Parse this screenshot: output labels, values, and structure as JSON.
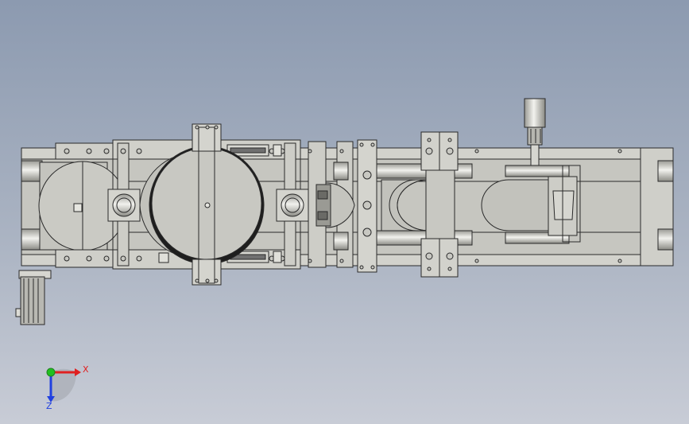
{
  "triad": {
    "x_label": "X",
    "z_label": "Z",
    "x_color": "#e02020",
    "y_color": "#20c020",
    "z_color": "#2040e0"
  },
  "colors": {
    "background_top": "#8c9ab0",
    "background_bottom": "#c8ccd6",
    "part_fill": "#c8c8c2",
    "part_fill_light": "#d8d8d2",
    "part_fill_dark": "#a8a8a2",
    "edge": "#2a2a2a"
  }
}
